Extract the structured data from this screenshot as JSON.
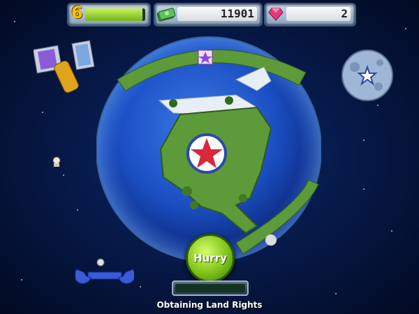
{
  "hud": {
    "level": "6",
    "level_progress": 0.95,
    "money": "11901",
    "gems": "2"
  },
  "actions": {
    "hurry_label": "Hurry"
  },
  "task": {
    "caption": "Obtaining Land Rights",
    "progress": 0.0
  },
  "colors": {
    "accent_green": "#7fc21a",
    "level_yellow": "#f5c400",
    "gem_pink": "#e8387a",
    "ocean_blue": "#1a4ec2",
    "land_green": "#5d9a3a"
  },
  "icons": {
    "money": "money-stack-icon",
    "gem": "pink-gem-icon",
    "satellite": "satellite-icon",
    "moon": "moon-icon",
    "wrench": "wrench-icon",
    "astronaut": "astronaut-icon",
    "star_base": "star-emblem-icon"
  }
}
